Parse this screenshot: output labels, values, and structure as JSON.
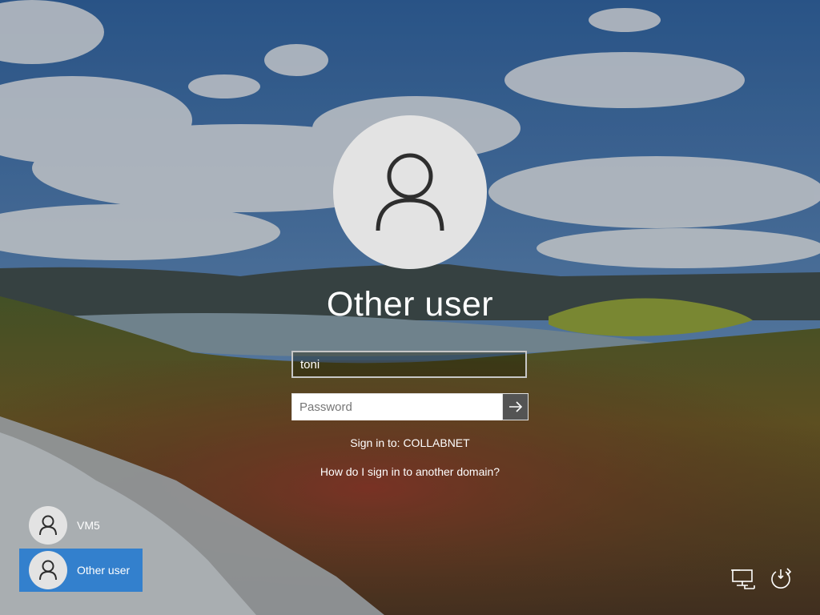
{
  "login": {
    "title": "Other user",
    "username_value": "toni",
    "password_placeholder": "Password",
    "sign_in_to": "Sign in to: COLLABNET",
    "domain_help_link": "How do I sign in to another domain?",
    "submit_icon": "arrow-right-icon",
    "avatar_icon": "user-silhouette-icon"
  },
  "user_list": [
    {
      "label": "VM5",
      "icon": "user-silhouette-icon",
      "selected": false
    },
    {
      "label": "Other user",
      "icon": "user-silhouette-icon",
      "selected": true
    }
  ],
  "system_icons": {
    "network": "network-icon",
    "power": "power-icon"
  },
  "colors": {
    "selected_tile": "#1e78d2",
    "avatar_bg": "#e3e3e3",
    "submit_button_bg": "#545454"
  }
}
